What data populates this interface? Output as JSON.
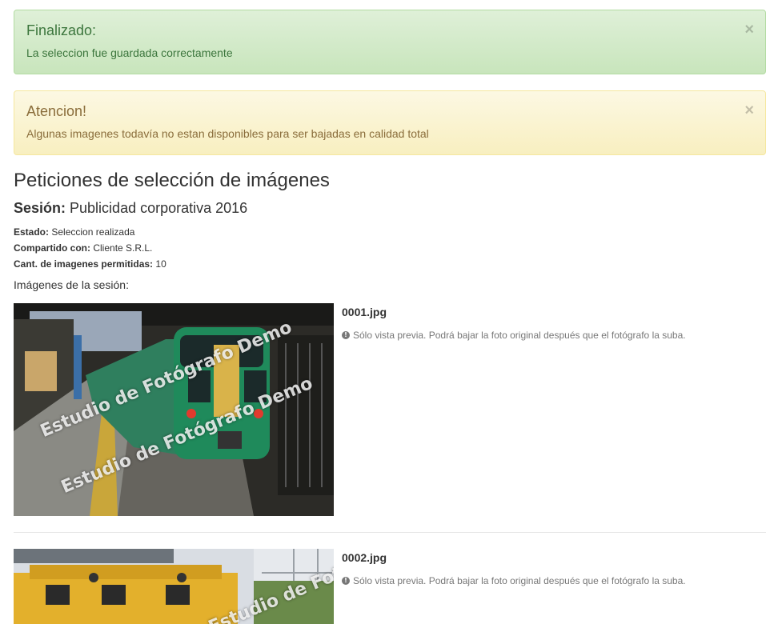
{
  "alerts": [
    {
      "type": "success",
      "title": "Finalizado:",
      "text": "La seleccion fue guardada correctamente",
      "close": "×"
    },
    {
      "type": "warning",
      "title": "Atencion!",
      "text": "Algunas imagenes todavía no estan disponibles para ser bajadas en calidad total",
      "close": "×"
    }
  ],
  "page": {
    "title": "Peticiones de selección de imágenes",
    "session_label": "Sesión:",
    "session_name": "Publicidad corporativa 2016"
  },
  "details": [
    {
      "label": "Estado:",
      "value": "Seleccion realizada"
    },
    {
      "label": "Compartido con:",
      "value": "Cliente S.R.L."
    },
    {
      "label": "Cant. de imagenes permitidas:",
      "value": "10"
    }
  ],
  "images_label": "Imágenes de la sesión:",
  "images": [
    {
      "file": "0001.jpg",
      "note": "Sólo vista previa. Podrá bajar la foto original después que el fotógrafo la suba.",
      "watermark": "Estudio de Fotógrafo Demo"
    },
    {
      "file": "0002.jpg",
      "note": "Sólo vista previa. Podrá bajar la foto original después que el fotógrafo la suba.",
      "watermark": "Estudio de Fotógrafo Demo"
    }
  ],
  "icons": {
    "info": "info-circle-icon",
    "close": "close-icon"
  },
  "colors": {
    "success_text": "#3c763d",
    "success_bg": "#dff0d8",
    "warning_text": "#8a6d3b",
    "warning_bg": "#fcf8e3"
  }
}
